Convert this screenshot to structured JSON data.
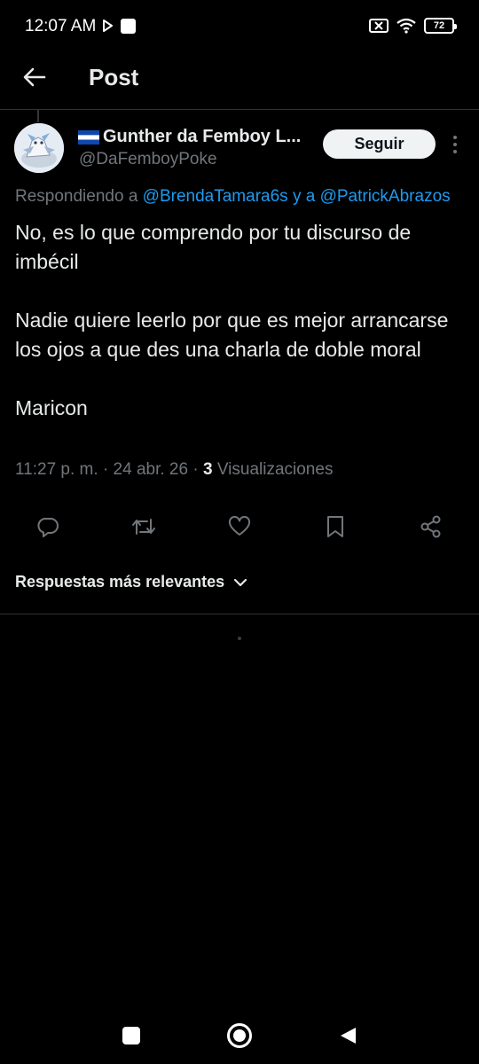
{
  "status_bar": {
    "time": "12:07 AM",
    "battery": "72",
    "icons": [
      "play-icon",
      "notification-square-icon",
      "sim-off-icon",
      "wifi-icon",
      "battery-icon"
    ]
  },
  "header": {
    "title": "Post",
    "back_icon": "arrow-left-icon"
  },
  "post": {
    "author": {
      "display_name": "Gunther da Femboy L...",
      "flag": "el-salvador-flag-icon",
      "handle": "@DaFemboyPoke"
    },
    "follow_label": "Seguir",
    "replying": {
      "prefix": "Respondiendo a",
      "mention1": "@BrendaTamara6s",
      "connector": "y a",
      "mention2": "@PatrickAbrazos"
    },
    "paragraphs": [
      "No, es lo que comprendo por tu discurso de imbécil",
      "Nadie quiere leerlo por que es mejor arrancarse los ojos a que des una charla de doble moral",
      "Maricon"
    ],
    "meta": {
      "time": "11:27 p. m.",
      "date": "24 abr. 26",
      "separator": "·",
      "views_count": "3",
      "views_label": "Visualizaciones"
    },
    "actions": [
      "reply-icon",
      "repost-icon",
      "like-icon",
      "bookmark-icon",
      "share-icon"
    ]
  },
  "replies_sort": {
    "label": "Respuestas más relevantes",
    "icon": "chevron-down-icon"
  },
  "colors": {
    "background": "#000000",
    "text": "#e7e9ea",
    "secondary": "#71767b",
    "accent": "#1d9bf0",
    "divider": "#2f3336"
  },
  "nav_bar": {
    "icons": [
      "recents-icon",
      "home-icon",
      "back-icon"
    ]
  }
}
